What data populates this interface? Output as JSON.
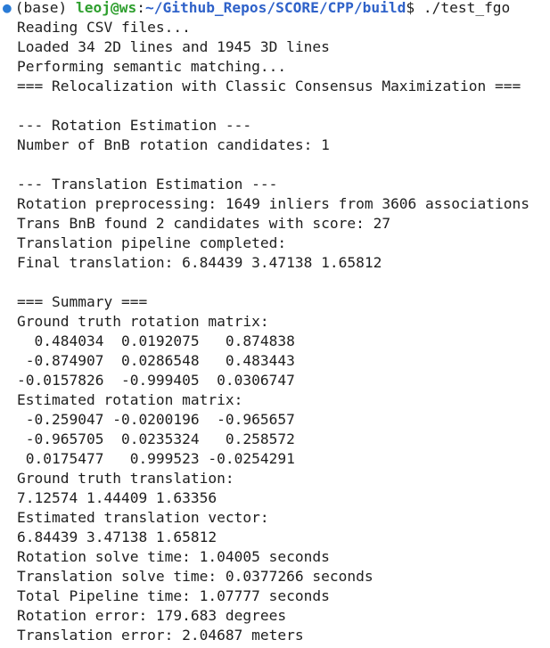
{
  "terminal": {
    "prompt": {
      "dot": "●",
      "env": "(base) ",
      "user_host": "leoj@ws",
      "sep": ":",
      "cwd": "~/Github_Repos/SCORE/CPP/build",
      "symbol": "$ ",
      "command": "./test_fgo"
    },
    "output": [
      "Reading CSV files...",
      "Loaded 34 2D lines and 1945 3D lines",
      "Performing semantic matching...",
      "=== Relocalization with Classic Consensus Maximization ===",
      "",
      "--- Rotation Estimation ---",
      "Number of BnB rotation candidates: 1",
      "",
      "--- Translation Estimation ---",
      "Rotation preprocessing: 1649 inliers from 3606 associations",
      "Trans BnB found 2 candidates with score: 27",
      "Translation pipeline completed:",
      "Final translation: 6.84439 3.47138 1.65812",
      "",
      "=== Summary ===",
      "Ground truth rotation matrix:",
      "  0.484034  0.0192075   0.874838",
      " -0.874907  0.0286548   0.483443",
      "-0.0157826  -0.999405  0.0306747",
      "Estimated rotation matrix:",
      " -0.259047 -0.0200196  -0.965657",
      " -0.965705  0.0235324   0.258572",
      " 0.0175477   0.999523 -0.0254291",
      "Ground truth translation:",
      "7.12574 1.44409 1.63356",
      "Estimated translation vector:",
      "6.84439 3.47138 1.65812",
      "Rotation solve time: 1.04005 seconds",
      "Translation solve time: 0.0377266 seconds",
      "Total Pipeline time: 1.07777 seconds",
      "Rotation error: 179.683 degrees",
      "Translation error: 2.04687 meters"
    ]
  },
  "colors": {
    "background": "#ffffff",
    "text": "#1e1e1e",
    "user_host": "#2e9f2e",
    "cwd": "#2f62c9",
    "dot": "#2a7bd6"
  }
}
